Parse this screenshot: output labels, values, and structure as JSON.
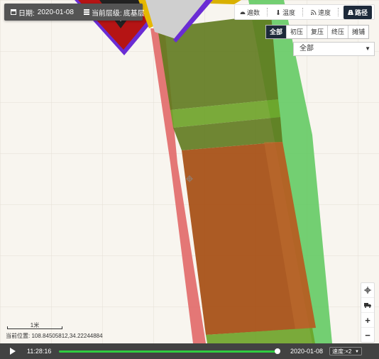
{
  "info": {
    "date_label": "日期:",
    "date_value": "2020-01-08",
    "layer_label": "当前层级:",
    "layer_value": "底基层"
  },
  "modes": [
    {
      "label": "遍数",
      "icon": "gauge-icon",
      "active": false
    },
    {
      "label": "温度",
      "icon": "thermometer-icon",
      "active": false
    },
    {
      "label": "速度",
      "icon": "rss-icon",
      "active": false
    },
    {
      "label": "路径",
      "icon": "road-icon",
      "active": true
    }
  ],
  "stages": [
    {
      "label": "全部",
      "active": true
    },
    {
      "label": "初压",
      "active": false
    },
    {
      "label": "复压",
      "active": false
    },
    {
      "label": "终压",
      "active": false
    },
    {
      "label": "摊铺",
      "active": false
    }
  ],
  "select": {
    "value": "全部"
  },
  "zoom": {
    "locate_icon": "crosshair-icon",
    "vehicle_icon": "truck-icon",
    "zoom_in": "+",
    "zoom_out": "−"
  },
  "scale": {
    "label": "1米"
  },
  "position": {
    "label": "当前位置:",
    "value": "108.84505812,34.22244884"
  },
  "playback": {
    "time": "11:28:16",
    "date": "2020-01-08",
    "progress": 0.99,
    "speed_label": "速度:",
    "speed_value": "×2"
  },
  "colors": {
    "accent": "#1d2a3a",
    "progress": "#2ecc40",
    "path_red": "#e06060",
    "path_green": "#5cc85c",
    "path_orange": "#a85218",
    "path_olive": "#5f7a1e"
  }
}
